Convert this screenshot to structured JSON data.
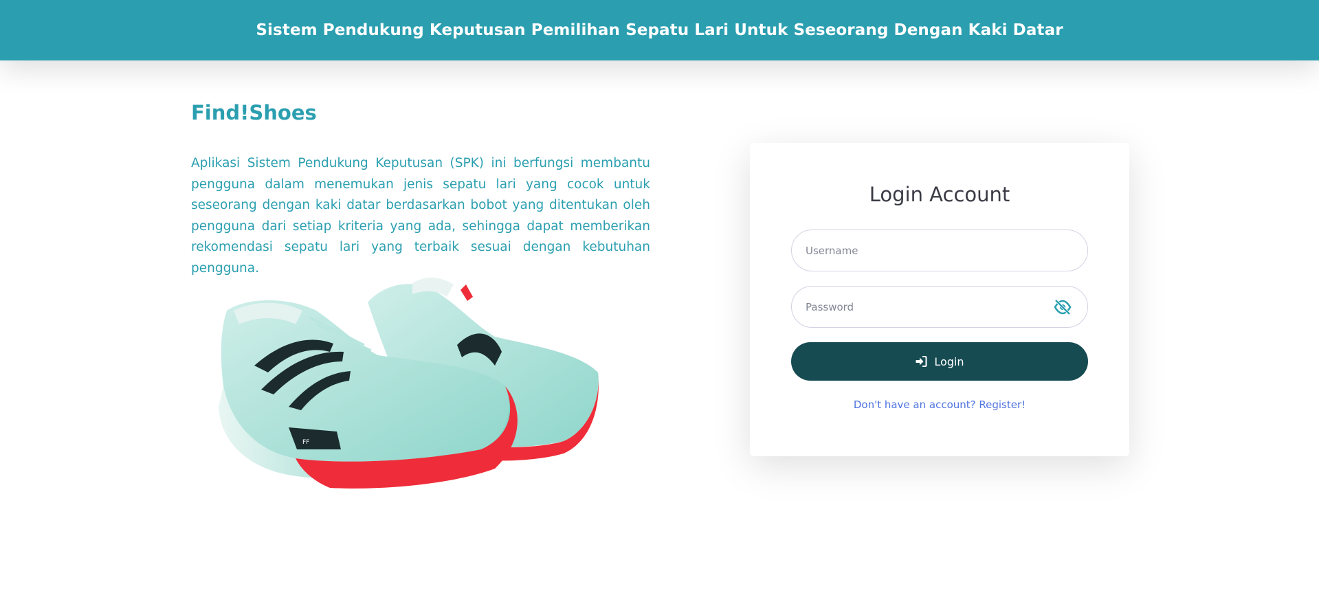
{
  "header": {
    "title": "Sistem Pendukung Keputusan Pemilihan Sepatu Lari Untuk Seseorang Dengan Kaki Datar",
    "background": "#2b9fb0"
  },
  "intro": {
    "brand": "Find!Shoes",
    "description": "Aplikasi Sistem Pendukung Keputusan (SPK) ini berfungsi membantu pengguna dalam menemukan jenis sepatu lari yang cocok untuk seseorang dengan kaki datar berdasarkan bobot yang ditentukan oleh pengguna dari setiap kriteria yang ada, sehingga dapat memberikan rekomendasi sepatu lari yang terbaik sesuai dengan kebutuhan pengguna.",
    "image_icon": "running-shoes-image"
  },
  "login": {
    "title": "Login Account",
    "username_placeholder": "Username",
    "password_placeholder": "Password",
    "toggle_icon": "eye-slash-icon",
    "button_icon": "sign-in-icon",
    "button_label": "Login",
    "register_link": "Don't have an account? Register!",
    "button_color": "#164b52",
    "link_color": "#4e73df"
  }
}
